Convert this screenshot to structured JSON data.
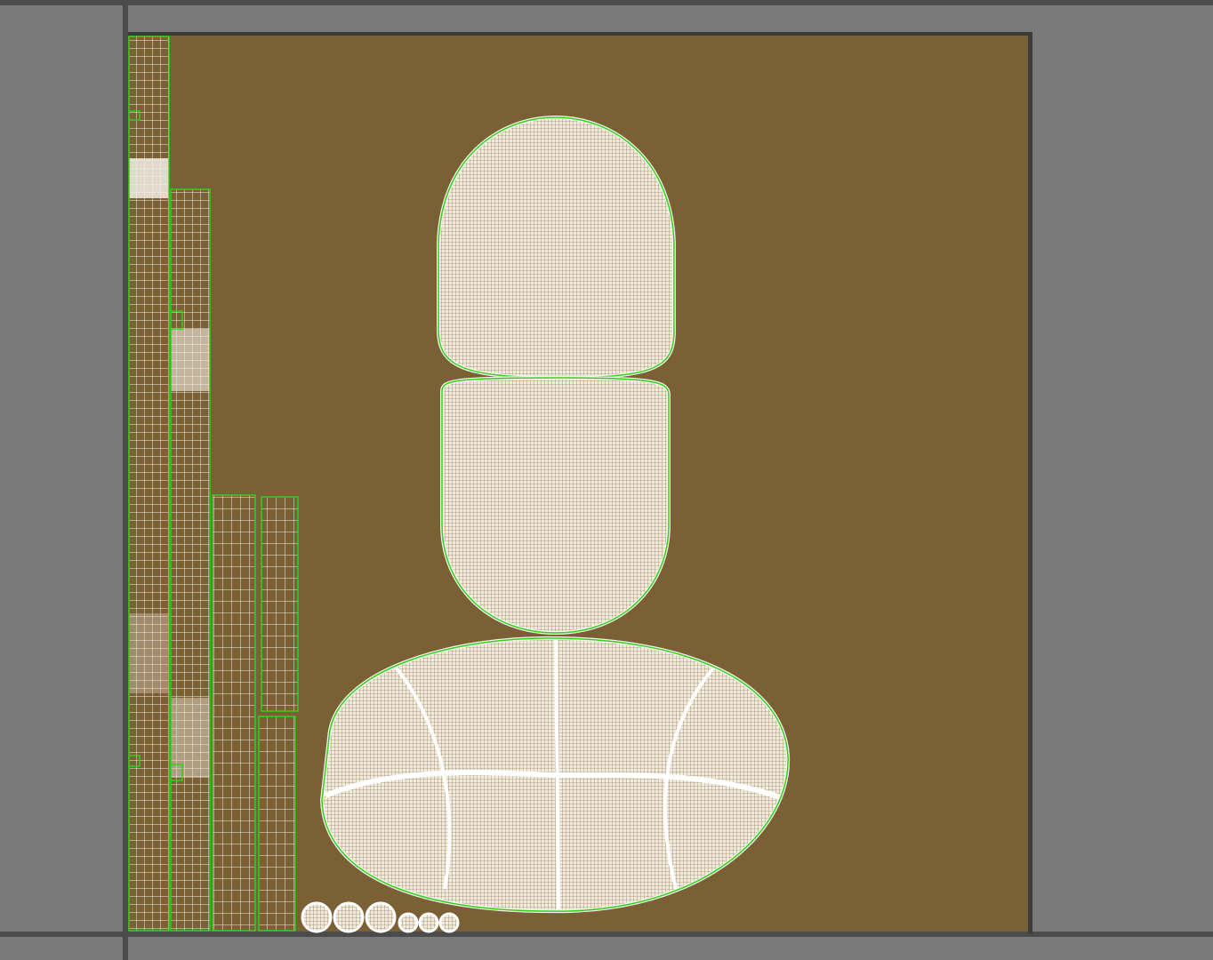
{
  "viewport": {
    "type": "uv-editor",
    "background_color": "#7a7a7a",
    "frame_color": "#4a4a4a",
    "texture_color": "#7b5f35"
  },
  "uv_islands": {
    "wire_color": "#f2ede2",
    "border_color": "#2fd11f",
    "strips": [
      {
        "name": "uv-strip-1"
      },
      {
        "name": "uv-strip-2"
      },
      {
        "name": "uv-strip-3"
      },
      {
        "name": "uv-strip-4"
      },
      {
        "name": "uv-strip-5"
      }
    ],
    "capsule_shells": [
      {
        "name": "uv-shell-top"
      },
      {
        "name": "uv-shell-middle"
      }
    ],
    "oval_shell": {
      "name": "uv-shell-oval"
    },
    "small_circles": 6
  }
}
